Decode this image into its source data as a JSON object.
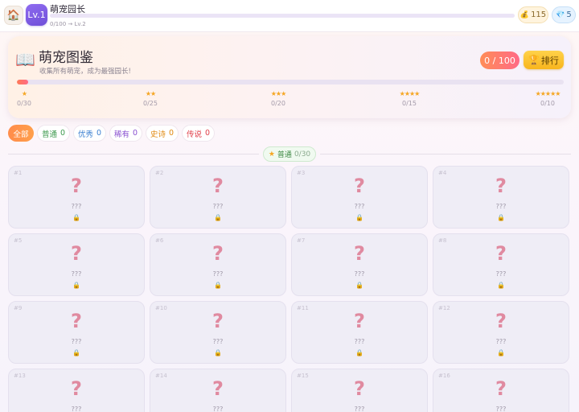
{
  "topbar": {
    "home_icon": "home-icon",
    "level": "Lv.1",
    "player_name": "萌宠园长",
    "xp_text": "0/100 → Lv.2",
    "xp_progress": 0.0,
    "coins": "115",
    "coin_icon": "money-bag-icon",
    "gems": "5",
    "gem_icon": "diamond-icon"
  },
  "collection": {
    "icon": "book-icon",
    "title": "萌宠图鉴",
    "subtitle": "收集所有萌宠，成为最强园长!",
    "progress_text": "0 / 100",
    "progress_fraction": 0.0,
    "rank_label": "排行",
    "rank_icon": "trophy-icon",
    "tiers": [
      {
        "stars": "★",
        "count": "0/30"
      },
      {
        "stars": "★★",
        "count": "0/25"
      },
      {
        "stars": "★★★",
        "count": "0/20"
      },
      {
        "stars": "★★★★",
        "count": "0/15"
      },
      {
        "stars": "★★★★★",
        "count": "0/10"
      }
    ]
  },
  "filters": [
    {
      "label": "全部",
      "count": "",
      "color": "#ffffff",
      "active": true
    },
    {
      "label": "普通",
      "count": "0",
      "color": "#3e9a4e",
      "active": false
    },
    {
      "label": "优秀",
      "count": "0",
      "color": "#3a7fd0",
      "active": false
    },
    {
      "label": "稀有",
      "count": "0",
      "color": "#8a52d0",
      "active": false
    },
    {
      "label": "史诗",
      "count": "0",
      "color": "#e0890f",
      "active": false
    },
    {
      "label": "传说",
      "count": "0",
      "color": "#e0404a",
      "active": false
    }
  ],
  "section": {
    "label": "普通",
    "count": "0/30"
  },
  "pets": [
    {
      "num": "#1",
      "name": "???"
    },
    {
      "num": "#2",
      "name": "???"
    },
    {
      "num": "#3",
      "name": "???"
    },
    {
      "num": "#4",
      "name": "???"
    },
    {
      "num": "#5",
      "name": "???"
    },
    {
      "num": "#6",
      "name": "???"
    },
    {
      "num": "#7",
      "name": "???"
    },
    {
      "num": "#8",
      "name": "???"
    },
    {
      "num": "#9",
      "name": "???"
    },
    {
      "num": "#10",
      "name": "???"
    },
    {
      "num": "#11",
      "name": "???"
    },
    {
      "num": "#12",
      "name": "???"
    },
    {
      "num": "#13",
      "name": "???"
    },
    {
      "num": "#14",
      "name": "???"
    },
    {
      "num": "#15",
      "name": "???"
    },
    {
      "num": "#16",
      "name": "???"
    }
  ],
  "pet_placeholder": "?",
  "lock_icon": "lock-icon"
}
